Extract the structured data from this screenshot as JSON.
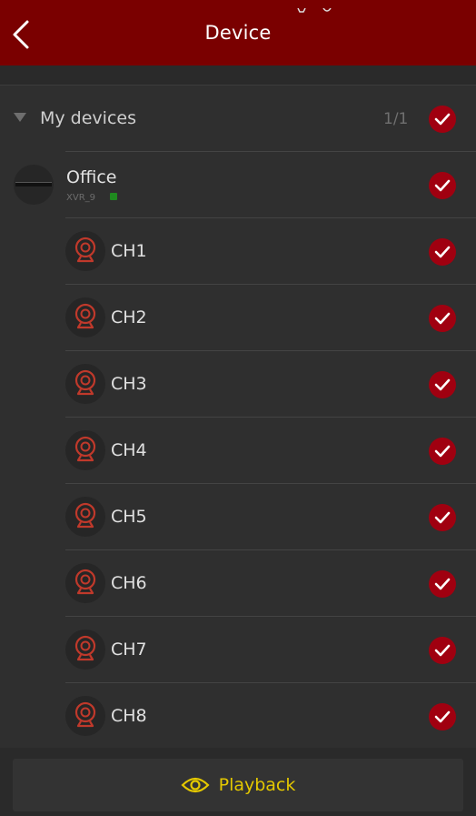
{
  "header": {
    "title": "Device"
  },
  "group": {
    "label": "My devices",
    "count": "1/1"
  },
  "device": {
    "name": "Office",
    "model": "XVR_9"
  },
  "channels": [
    {
      "label": "CH1"
    },
    {
      "label": "CH2"
    },
    {
      "label": "CH3"
    },
    {
      "label": "CH4"
    },
    {
      "label": "CH5"
    },
    {
      "label": "CH6"
    },
    {
      "label": "CH7"
    },
    {
      "label": "CH8"
    }
  ],
  "footer": {
    "playback_label": "Playback"
  },
  "colors": {
    "header_bg": "#7a0000",
    "check_bg": "#a00010",
    "camera_icon": "#c0392b",
    "playback_accent": "#e4c800",
    "online_dot": "#1f8a1f"
  },
  "icons": {
    "back": "chevron-left-icon",
    "check": "checkmark-icon",
    "camera": "camera-icon",
    "eye": "eye-icon",
    "expand": "triangle-down-icon"
  }
}
